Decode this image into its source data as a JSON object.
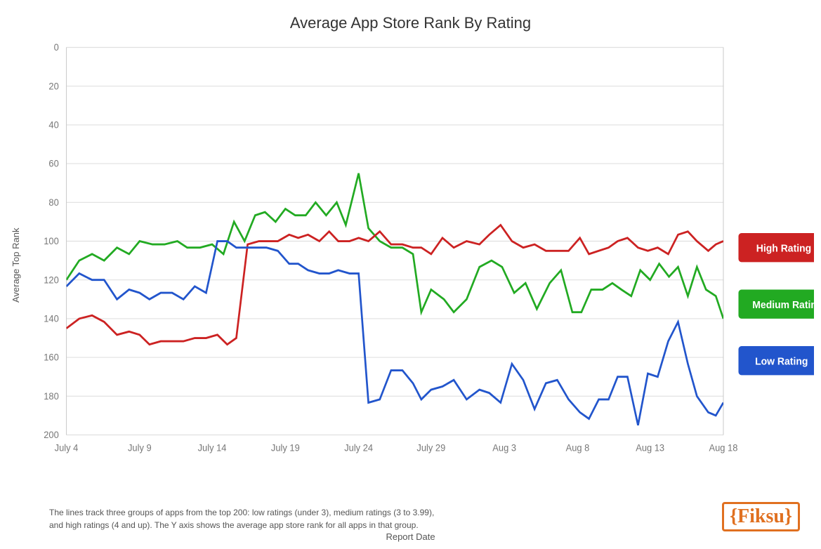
{
  "title": "Average App Store Rank By Rating",
  "yAxisLabel": "Average Top Rank",
  "xAxisLabel": "Report Date",
  "yTicks": [
    0,
    20,
    40,
    60,
    80,
    100,
    120,
    140,
    160,
    180,
    200
  ],
  "xLabels": [
    "July 4",
    "July 9",
    "July 14",
    "July 19",
    "July 24",
    "July 29",
    "Aug 3",
    "Aug 8",
    "Aug 13",
    "Aug 18"
  ],
  "legend": {
    "high": {
      "label": "High Rating",
      "color": "#cc2222"
    },
    "medium": {
      "label": "Medium Rating",
      "color": "#22aa22"
    },
    "low": {
      "label": "Low Rating",
      "color": "#2255cc"
    }
  },
  "footer": {
    "text1": "The lines track three groups of apps from the top 200: low ratings (under 3), medium ratings (3 to 3.99),",
    "text2": "and high ratings (4 and up). The Y axis shows the average app store rank for all apps in that group.",
    "logo": "{Fiksu}"
  }
}
